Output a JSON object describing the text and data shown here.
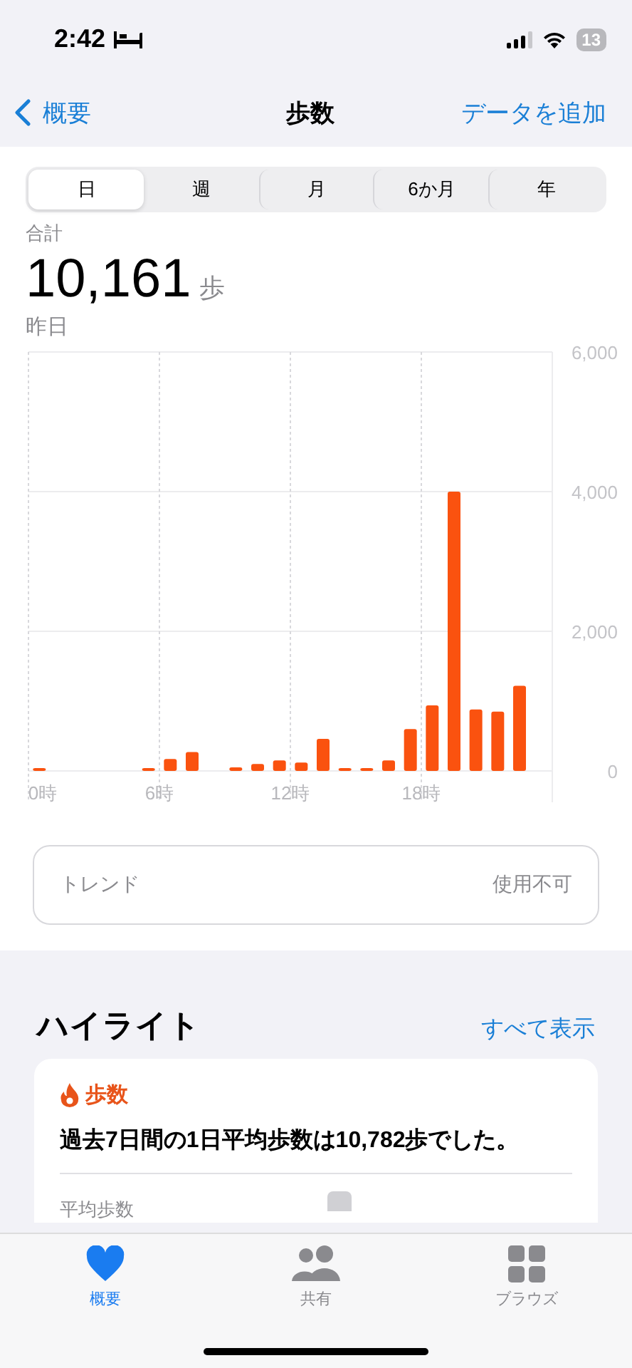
{
  "status_bar": {
    "time": "2:42",
    "battery": "13"
  },
  "nav": {
    "back": "概要",
    "title": "歩数",
    "action": "データを追加"
  },
  "segments": [
    {
      "label": "日",
      "selected": true
    },
    {
      "label": "週",
      "selected": false
    },
    {
      "label": "月",
      "selected": false
    },
    {
      "label": "6か月",
      "selected": false
    },
    {
      "label": "年",
      "selected": false
    }
  ],
  "summary": {
    "label": "合計",
    "value": "10,161",
    "unit": "歩",
    "date": "昨日"
  },
  "chart_data": {
    "type": "bar",
    "x": [
      0.5,
      5.5,
      6.5,
      7.5,
      9.5,
      10.5,
      11.5,
      12.5,
      13.5,
      14.5,
      15.5,
      16.5,
      17.5,
      18.5,
      19.5,
      20.5,
      21.5,
      22.5
    ],
    "values": [
      40,
      40,
      170,
      270,
      50,
      100,
      150,
      120,
      460,
      40,
      40,
      150,
      600,
      940,
      4000,
      880,
      850,
      1220
    ],
    "xlim": [
      0,
      24
    ],
    "grid": true,
    "ylim": [
      0,
      6000
    ],
    "xticks": [
      {
        "value": 0,
        "label": "0時"
      },
      {
        "value": 6,
        "label": "6時"
      },
      {
        "value": 12,
        "label": "12時"
      },
      {
        "value": 18,
        "label": "18時"
      }
    ],
    "yticks": [
      {
        "value": 0,
        "label": "0"
      },
      {
        "value": 2000,
        "label": "2,000"
      },
      {
        "value": 4000,
        "label": "4,000"
      },
      {
        "value": 6000,
        "label": "6,000"
      }
    ]
  },
  "trend": {
    "label": "トレンド",
    "value": "使用不可"
  },
  "highlights": {
    "title": "ハイライト",
    "link": "すべて表示",
    "card": {
      "category": "歩数",
      "text": "過去7日間の1日平均歩数は10,782歩でした。",
      "sub_label": "平均歩数"
    }
  },
  "tab_bar": [
    {
      "kind": "heart",
      "label": "概要",
      "selected": true
    },
    {
      "kind": "people",
      "label": "共有",
      "selected": false
    },
    {
      "kind": "grid",
      "label": "ブラウズ",
      "selected": false
    }
  ]
}
